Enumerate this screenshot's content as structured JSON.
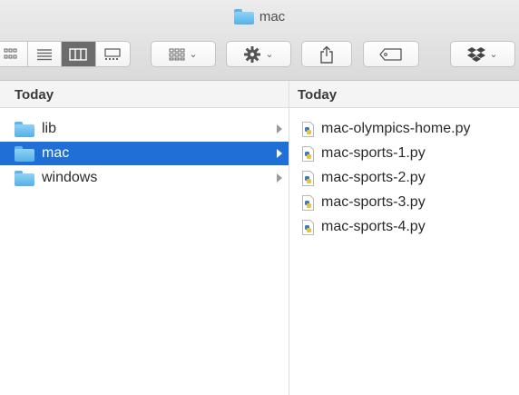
{
  "window": {
    "title": "mac"
  },
  "toolbar": {
    "view_buttons": [
      "icon-view",
      "list-view",
      "column-view",
      "gallery-view"
    ],
    "active_view": "column-view",
    "arrange_icon": "arrange-grid-icon",
    "action_icon": "gear-icon",
    "share_icon": "share-icon",
    "tag_icon": "tag-icon",
    "dropbox_icon": "dropbox-icon"
  },
  "columns": [
    {
      "header": "Today",
      "items": [
        {
          "label": "lib",
          "type": "folder",
          "selected": false
        },
        {
          "label": "mac",
          "type": "folder",
          "selected": true
        },
        {
          "label": "windows",
          "type": "folder",
          "selected": false
        }
      ]
    },
    {
      "header": "Today",
      "items": [
        {
          "label": "mac-olympics-home.py",
          "type": "python-file"
        },
        {
          "label": "mac-sports-1.py",
          "type": "python-file"
        },
        {
          "label": "mac-sports-2.py",
          "type": "python-file"
        },
        {
          "label": "mac-sports-3.py",
          "type": "python-file"
        },
        {
          "label": "mac-sports-4.py",
          "type": "python-file"
        }
      ]
    }
  ],
  "colors": {
    "selection": "#1f6fd6",
    "folder": "#56b0e6"
  }
}
